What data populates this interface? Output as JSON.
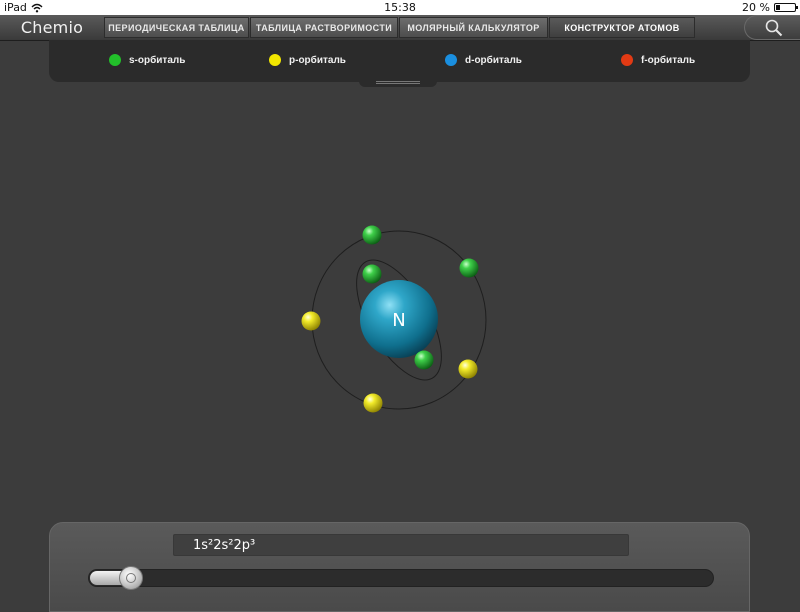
{
  "status_bar": {
    "device": "iPad",
    "time": "15:38",
    "battery": "20 %",
    "battery_level": 0.2
  },
  "app": {
    "title": "Chemio"
  },
  "tabs": [
    {
      "label": "ПЕРИОДИЧЕСКАЯ ТАБЛИЦА",
      "active": false
    },
    {
      "label": "ТАБЛИЦА РАСТВОРИМОСТИ",
      "active": false
    },
    {
      "label": "МОЛЯРНЫЙ КАЛЬКУЛЯТОР",
      "active": false
    },
    {
      "label": "КОНСТРУКТОР АТОМОВ",
      "active": true
    }
  ],
  "legend": [
    {
      "label": "s-орбиталь",
      "color": "#22c02a"
    },
    {
      "label": "p-орбиталь",
      "color": "#f2e600"
    },
    {
      "label": "d-орбиталь",
      "color": "#1a8fe0"
    },
    {
      "label": "f-орбиталь",
      "color": "#e23a14"
    }
  ],
  "atom": {
    "symbol": "N",
    "nucleus_color": "#1d8fb2",
    "s_electron_color": "#22b02c",
    "p_electron_color": "#efe21a",
    "electrons": [
      {
        "orbital": "s"
      },
      {
        "orbital": "s"
      },
      {
        "orbital": "s"
      },
      {
        "orbital": "s"
      },
      {
        "orbital": "p"
      },
      {
        "orbital": "p"
      },
      {
        "orbital": "p"
      }
    ]
  },
  "configuration": {
    "text": "1s²2s²2p³"
  },
  "slider": {
    "value_fraction": 0.067
  }
}
